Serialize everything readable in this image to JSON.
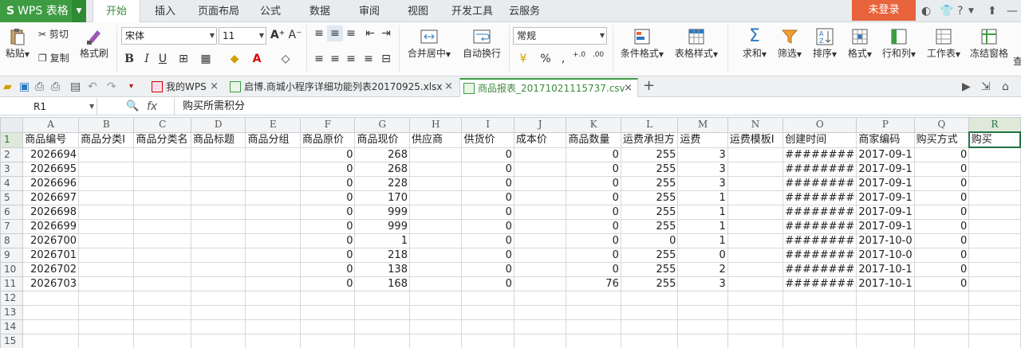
{
  "app": {
    "logo_text": "WPS 表格",
    "login": "未登录"
  },
  "menu": [
    "开始",
    "插入",
    "页面布局",
    "公式",
    "数据",
    "审阅",
    "视图",
    "开发工具",
    "云服务"
  ],
  "ribbon": {
    "paste": "粘贴",
    "cut": "剪切",
    "copy": "复制",
    "format_painter": "格式刷",
    "font": "宋体",
    "font_size": "11",
    "merge": "合并居中",
    "wrap": "自动换行",
    "num_format": "常规",
    "percent": "%",
    "comma": "‚",
    "dec_inc": "+.0",
    "dec_dec": ".00",
    "cond_format": "条件格式",
    "table_style": "表格样式",
    "sum": "求和",
    "filter": "筛选",
    "sort": "排序",
    "format": "格式",
    "rowcol": "行和列",
    "sheet": "工作表",
    "freeze": "冻结窗格",
    "more": "查"
  },
  "tabs": [
    {
      "label": "我的WPS",
      "active": false
    },
    {
      "label": "启博.商城小程序详细功能列表20170925.xlsx",
      "active": false
    },
    {
      "label": "商品报表_20171021115737.csv",
      "active": true
    }
  ],
  "formula_bar": {
    "cell": "R1",
    "fx": "fx",
    "content": "购买所需积分"
  },
  "sheet": {
    "columns": [
      "A",
      "B",
      "C",
      "D",
      "E",
      "F",
      "G",
      "H",
      "I",
      "J",
      "K",
      "L",
      "M",
      "N",
      "O",
      "P",
      "Q",
      "R"
    ],
    "rows": [
      [
        "商品编号",
        "商品分类I",
        "商品分类名",
        "商品标题",
        "商品分组",
        "商品原价",
        "商品现价",
        "供应商",
        "供货价",
        "成本价",
        "商品数量",
        "运费承担方",
        "运费",
        "运费模板I",
        "创建时间",
        "商家编码",
        "购买方式",
        "购买"
      ],
      [
        "2026694",
        "",
        "",
        "",
        "",
        "0",
        "268",
        "",
        "0",
        "",
        "0",
        "255",
        "3",
        "",
        "########",
        "2017-09-1",
        "0",
        ""
      ],
      [
        "2026695",
        "",
        "",
        "",
        "",
        "0",
        "268",
        "",
        "0",
        "",
        "0",
        "255",
        "3",
        "",
        "########",
        "2017-09-1",
        "0",
        ""
      ],
      [
        "2026696",
        "",
        "",
        "",
        "",
        "0",
        "228",
        "",
        "0",
        "",
        "0",
        "255",
        "3",
        "",
        "########",
        "2017-09-1",
        "0",
        ""
      ],
      [
        "2026697",
        "",
        "",
        "",
        "",
        "0",
        "170",
        "",
        "0",
        "",
        "0",
        "255",
        "1",
        "",
        "########",
        "2017-09-1",
        "0",
        ""
      ],
      [
        "2026698",
        "",
        "",
        "",
        "",
        "0",
        "999",
        "",
        "0",
        "",
        "0",
        "255",
        "1",
        "",
        "########",
        "2017-09-1",
        "0",
        ""
      ],
      [
        "2026699",
        "",
        "",
        "",
        "",
        "0",
        "999",
        "",
        "0",
        "",
        "0",
        "255",
        "1",
        "",
        "########",
        "2017-09-1",
        "0",
        ""
      ],
      [
        "2026700",
        "",
        "",
        "",
        "",
        "0",
        "1",
        "",
        "0",
        "",
        "0",
        "0",
        "1",
        "",
        "########",
        "2017-10-0",
        "0",
        ""
      ],
      [
        "2026701",
        "",
        "",
        "",
        "",
        "0",
        "218",
        "",
        "0",
        "",
        "0",
        "255",
        "0",
        "",
        "########",
        "2017-10-0",
        "0",
        ""
      ],
      [
        "2026702",
        "",
        "",
        "",
        "",
        "0",
        "138",
        "",
        "0",
        "",
        "0",
        "255",
        "2",
        "",
        "########",
        "2017-10-1",
        "0",
        ""
      ],
      [
        "2026703",
        "",
        "",
        "",
        "",
        "0",
        "168",
        "",
        "0",
        "",
        "76",
        "255",
        "3",
        "",
        "########",
        "2017-10-1",
        "0",
        ""
      ],
      [
        "",
        "",
        "",
        "",
        "",
        "",
        "",
        "",
        "",
        "",
        "",
        "",
        "",
        "",
        "",
        "",
        "",
        ""
      ],
      [
        "",
        "",
        "",
        "",
        "",
        "",
        "",
        "",
        "",
        "",
        "",
        "",
        "",
        "",
        "",
        "",
        "",
        ""
      ],
      [
        "",
        "",
        "",
        "",
        "",
        "",
        "",
        "",
        "",
        "",
        "",
        "",
        "",
        "",
        "",
        "",
        "",
        ""
      ],
      [
        "",
        "",
        "",
        "",
        "",
        "",
        "",
        "",
        "",
        "",
        "",
        "",
        "",
        "",
        "",
        "",
        "",
        ""
      ]
    ]
  }
}
